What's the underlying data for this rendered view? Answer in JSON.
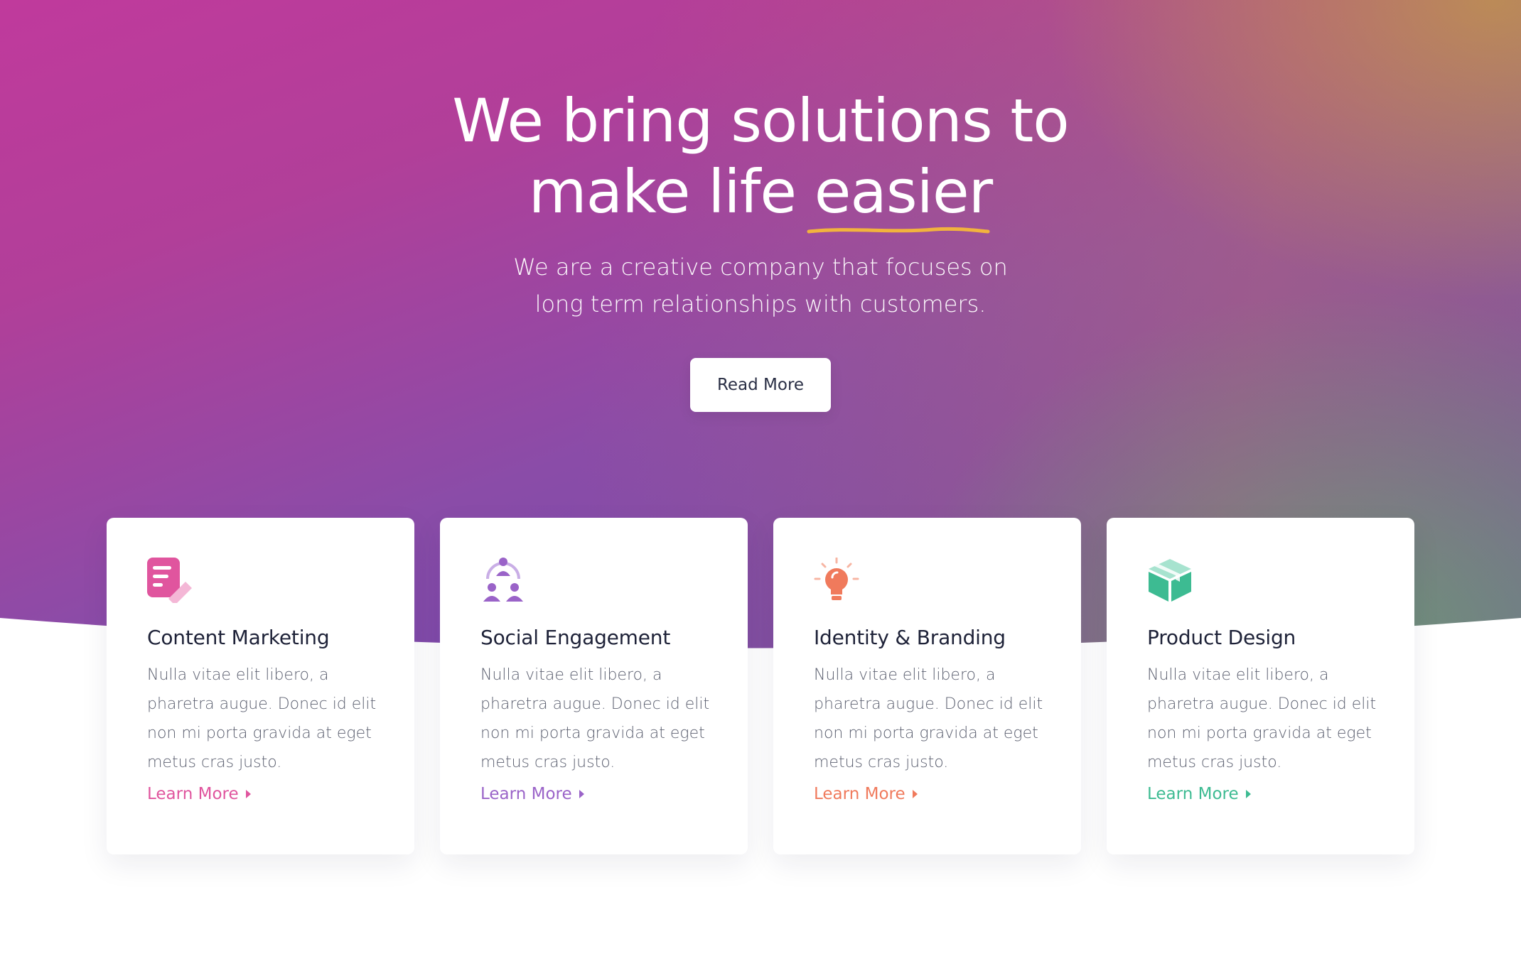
{
  "hero": {
    "headline_line1": "We bring solutions to",
    "headline_line2_prefix": "make life ",
    "headline_highlight": "easier",
    "subtitle": "We are a creative company that focuses on long term relationships with customers.",
    "cta_label": "Read More",
    "underline_color": "#f2b33d"
  },
  "cards": [
    {
      "icon": "document-edit-icon",
      "title": "Content Marketing",
      "text": "Nulla vitae elit libero, a pharetra augue. Donec id elit non mi porta gravida at eget metus cras justo.",
      "link": "Learn More",
      "color": "#e0559e"
    },
    {
      "icon": "people-network-icon",
      "title": "Social Engagement",
      "text": "Nulla vitae elit libero, a pharetra augue. Donec id elit non mi porta gravida at eget metus cras justo.",
      "link": "Learn More",
      "color": "#9a63c8"
    },
    {
      "icon": "lightbulb-icon",
      "title": "Identity & Branding",
      "text": "Nulla vitae elit libero, a pharetra augue. Donec id elit non mi porta gravida at eget metus cras justo.",
      "link": "Learn More",
      "color": "#f07a5c"
    },
    {
      "icon": "box-icon",
      "title": "Product Design",
      "text": "Nulla vitae elit libero, a pharetra augue. Donec id elit non mi porta gravida at eget metus cras justo.",
      "link": "Learn More",
      "color": "#3dbb92"
    }
  ]
}
